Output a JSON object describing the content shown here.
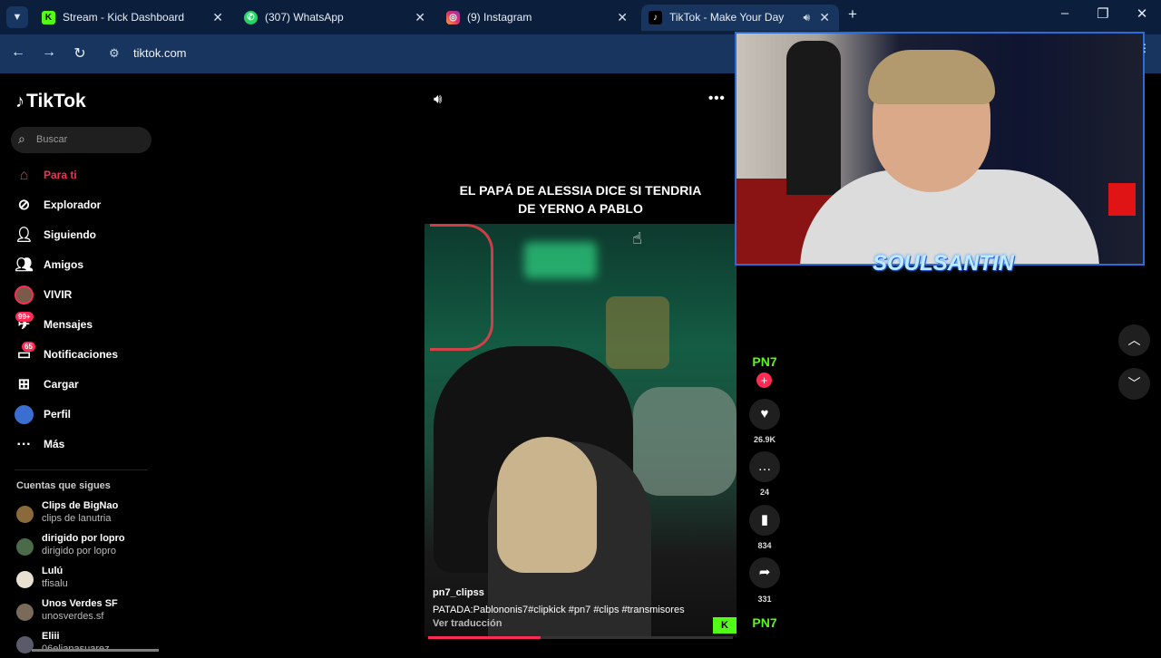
{
  "browser": {
    "tabs": [
      {
        "label": "Stream - Kick Dashboard",
        "favicon": "K",
        "active": false
      },
      {
        "label": "(307) WhatsApp",
        "favicon": "whatsapp-icon",
        "active": false
      },
      {
        "label": "(9) Instagram",
        "favicon": "instagram-icon",
        "active": false
      },
      {
        "label": "TikTok - Make Your Day",
        "favicon": "tiktok-icon",
        "active": true
      }
    ],
    "url": "tiktok.com",
    "colors": {
      "tabbar": "#0b1f3d",
      "toolbar": "#17355f"
    }
  },
  "sidebar": {
    "logo": "TikTok",
    "search_placeholder": "Buscar",
    "nav": [
      {
        "label": "Para ti",
        "icon": "home-icon",
        "active": true
      },
      {
        "label": "Explorador",
        "icon": "compass-icon"
      },
      {
        "label": "Siguiendo",
        "icon": "following-icon"
      },
      {
        "label": "Amigos",
        "icon": "friends-icon"
      },
      {
        "label": "VIVIR",
        "icon": "live-avatar-icon"
      },
      {
        "label": "Mensajes",
        "icon": "messages-icon",
        "badge": "99+"
      },
      {
        "label": "Notificaciones",
        "icon": "notifications-icon",
        "badge": "65"
      },
      {
        "label": "Cargar",
        "icon": "upload-icon"
      },
      {
        "label": "Perfil",
        "icon": "profile-icon"
      },
      {
        "label": "Más",
        "icon": "more-icon"
      }
    ],
    "following_header": "Cuentas que sigues",
    "following": [
      {
        "name": "Clips de BigNao",
        "handle": "clips de lanutria"
      },
      {
        "name": "dirigido por lopro",
        "handle": "dirigido por lopro"
      },
      {
        "name": "Lulú",
        "handle": "tfisalu"
      },
      {
        "name": "Unos Verdes SF",
        "handle": "unosverdes.sf"
      },
      {
        "name": "Eliii",
        "handle": "06elianasuarez"
      }
    ]
  },
  "video": {
    "caption_line1": "EL PAPÁ DE ALESSIA DICE SI TENDRIA",
    "caption_line2": "DE YERNO A PABLO",
    "username": "pn7_clipss",
    "description": "PATADA:Pablononis7#clipkick #pn7 #clips #transmisores",
    "translate": "Ver traducción",
    "watermark": "K",
    "progress_fraction": 0.37
  },
  "actions": {
    "creator_avatar": "PN7",
    "likes": "26.9K",
    "comments": "24",
    "saves": "834",
    "shares": "331",
    "music_avatar": "PN7"
  },
  "overlay": {
    "logo": "SOULSANTIN"
  }
}
